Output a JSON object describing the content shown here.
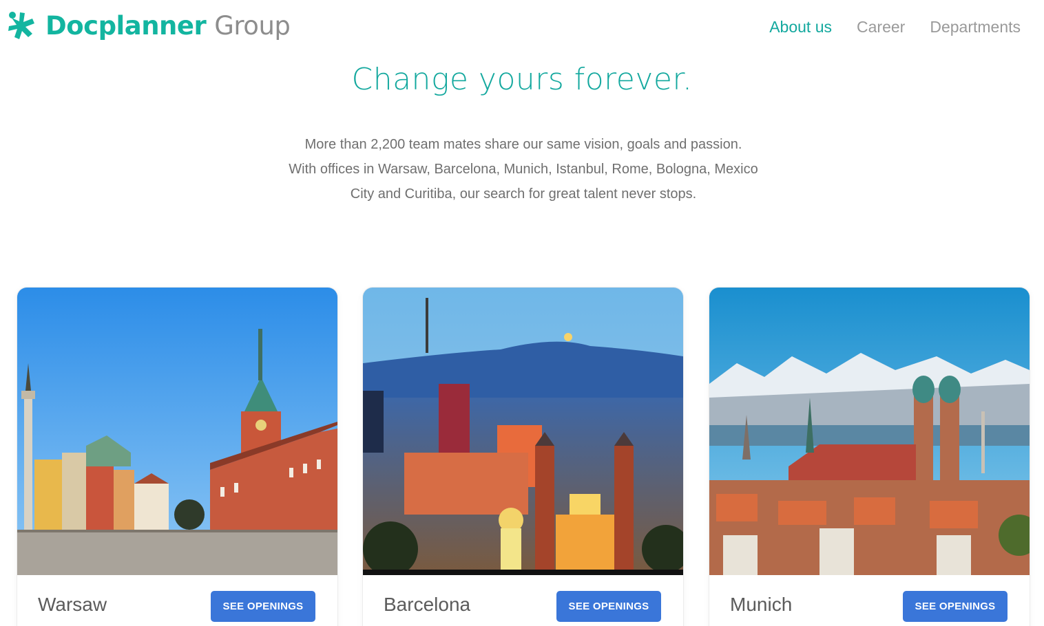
{
  "header": {
    "logo_brand": "Docplanner",
    "logo_group": "Group",
    "nav": [
      {
        "label": "About us",
        "active": true
      },
      {
        "label": "Career",
        "active": false
      },
      {
        "label": "Departments",
        "active": false
      }
    ]
  },
  "hero": {
    "title": "Change yours forever.",
    "lines": [
      "More than 2,200 team mates share our same vision, goals and passion.",
      "With offices in Warsaw, Barcelona, Munich, Istanbul, Rome, Bologna, Mexico",
      "City and Curitiba, our search for great talent never stops."
    ]
  },
  "cities": [
    {
      "name": "Warsaw",
      "button": "SEE OPENINGS"
    },
    {
      "name": "Barcelona",
      "button": "SEE OPENINGS"
    },
    {
      "name": "Munich",
      "button": "SEE OPENINGS"
    }
  ],
  "colors": {
    "brand": "#13b5a0",
    "accent": "#13a89e",
    "button": "#3a76d9",
    "muted_text": "#6f6f6f"
  }
}
